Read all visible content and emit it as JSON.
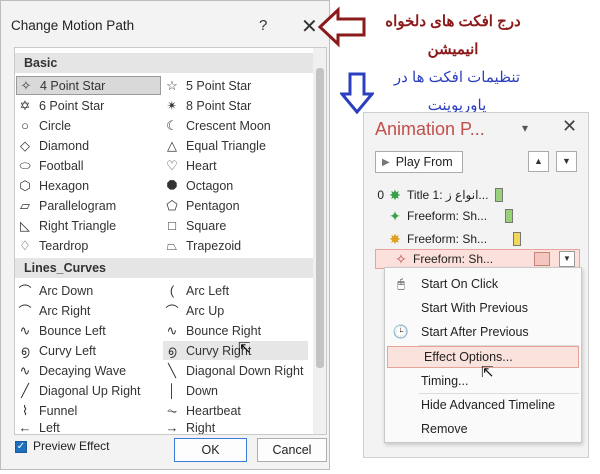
{
  "dialog": {
    "title": "Change Motion Path",
    "help": "?",
    "close": "✕",
    "sections": [
      {
        "label": "Basic"
      },
      {
        "label": "Lines_Curves"
      }
    ],
    "basic_items": [
      {
        "icon": "✧",
        "label": "4 Point Star"
      },
      {
        "icon": "☆",
        "label": "5 Point Star"
      },
      {
        "icon": "✡",
        "label": "6 Point Star"
      },
      {
        "icon": "✴",
        "label": "8 Point Star"
      },
      {
        "icon": "○",
        "label": "Circle"
      },
      {
        "icon": "☾",
        "label": "Crescent Moon"
      },
      {
        "icon": "◇",
        "label": "Diamond"
      },
      {
        "icon": "△",
        "label": "Equal Triangle"
      },
      {
        "icon": "⬭",
        "label": "Football"
      },
      {
        "icon": "♡",
        "label": "Heart"
      },
      {
        "icon": "⬡",
        "label": "Hexagon"
      },
      {
        "icon": "⯃",
        "label": "Octagon"
      },
      {
        "icon": "▱",
        "label": "Parallelogram"
      },
      {
        "icon": "⬠",
        "label": "Pentagon"
      },
      {
        "icon": "◺",
        "label": "Right Triangle"
      },
      {
        "icon": "□",
        "label": "Square"
      },
      {
        "icon": "♢",
        "label": "Teardrop"
      },
      {
        "icon": "⏢",
        "label": "Trapezoid"
      }
    ],
    "curve_items": [
      {
        "icon": "⌒",
        "label": "Arc Down"
      },
      {
        "icon": "(",
        "label": "Arc Left"
      },
      {
        "icon": "⌒",
        "label": "Arc Right"
      },
      {
        "icon": "⌒",
        "label": "Arc Up"
      },
      {
        "icon": "∿",
        "label": "Bounce Left"
      },
      {
        "icon": "∿",
        "label": "Bounce Right"
      },
      {
        "icon": "൭",
        "label": "Curvy Left"
      },
      {
        "icon": "൭",
        "label": "Curvy Right"
      },
      {
        "icon": "∿",
        "label": "Decaying Wave"
      },
      {
        "icon": "╲",
        "label": "Diagonal Down Right"
      },
      {
        "icon": "╱",
        "label": "Diagonal Up Right"
      },
      {
        "icon": "│",
        "label": "Down"
      },
      {
        "icon": "⌇",
        "label": "Funnel"
      },
      {
        "icon": "⏦",
        "label": "Heartbeat"
      },
      {
        "icon": "←",
        "label": "Left"
      },
      {
        "icon": "→",
        "label": "Right"
      }
    ],
    "preview_effect": "Preview Effect",
    "ok": "OK",
    "cancel": "Cancel"
  },
  "annotations": {
    "red": "درج افکت های دلخواه انیمیشن",
    "blue": "تنظیمات افکت ها در پاورپوینت"
  },
  "pane": {
    "title": "Animation P...",
    "caret": "▾",
    "close": "✕",
    "play_from": "Play From",
    "up": "▲",
    "down": "▼",
    "rows": [
      {
        "num": "0",
        "label": "Title 1: انواع ز...",
        "color": "#3aa04a"
      },
      {
        "num": "",
        "label": "Freeform: Sh...",
        "color": "#3aa04a"
      },
      {
        "num": "",
        "label": "Freeform: Sh...",
        "color": "#e0a020"
      },
      {
        "num": "",
        "label": "Freeform: Sh...",
        "color": "#c0504d"
      }
    ],
    "dropdown": "▼"
  },
  "menu": {
    "items": [
      {
        "label": "Start On Click",
        "icon": "🖰"
      },
      {
        "label": "Start With Previous",
        "icon": ""
      },
      {
        "label": "Start After Previous",
        "icon": "🕒"
      },
      {
        "label": "Effect Options...",
        "icon": ""
      },
      {
        "label": "Timing...",
        "icon": ""
      },
      {
        "label": "Hide Advanced Timeline",
        "icon": ""
      },
      {
        "label": "Remove",
        "icon": ""
      }
    ]
  }
}
